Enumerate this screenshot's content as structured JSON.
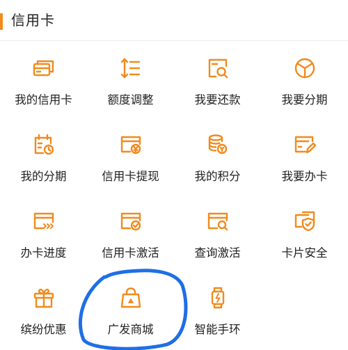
{
  "header": {
    "title": "信用卡"
  },
  "accent_color": "#f28a1c",
  "annotation_color": "#1e6fe6",
  "items": [
    {
      "label": "我的信用卡",
      "icon": "card-stack-icon"
    },
    {
      "label": "额度调整",
      "icon": "adjust-arrows-icon"
    },
    {
      "label": "我要还款",
      "icon": "repay-search-icon"
    },
    {
      "label": "我要分期",
      "icon": "pie-circle-icon"
    },
    {
      "label": "我的分期",
      "icon": "installment-clock-icon"
    },
    {
      "label": "信用卡提现",
      "icon": "card-cash-icon"
    },
    {
      "label": "我的积分",
      "icon": "coin-stack-icon"
    },
    {
      "label": "我要办卡",
      "icon": "card-edit-icon"
    },
    {
      "label": "办卡进度",
      "icon": "card-progress-icon"
    },
    {
      "label": "信用卡激活",
      "icon": "card-activate-icon"
    },
    {
      "label": "查询激活",
      "icon": "query-activate-icon"
    },
    {
      "label": "卡片安全",
      "icon": "card-shield-icon"
    },
    {
      "label": "缤纷优惠",
      "icon": "gift-icon"
    },
    {
      "label": "广发商城",
      "icon": "shopping-bag-icon"
    },
    {
      "label": "智能手环",
      "icon": "smart-band-icon"
    }
  ]
}
